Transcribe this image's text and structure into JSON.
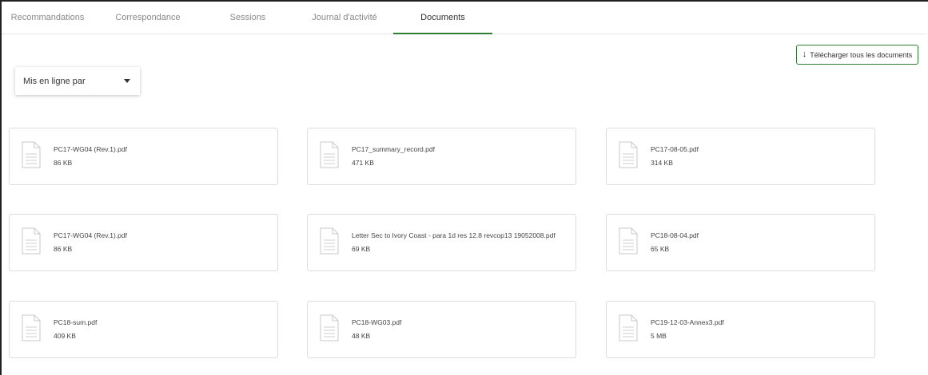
{
  "tabs": [
    {
      "label": "Recommandations",
      "active": false
    },
    {
      "label": "Correspondance",
      "active": false
    },
    {
      "label": "Sessions",
      "active": false
    },
    {
      "label": "Journal d'activité",
      "active": false
    },
    {
      "label": "Documents",
      "active": true
    }
  ],
  "toolbar": {
    "download_all_label": "Télécharger tous les documents",
    "download_icon": "download-arrow-icon"
  },
  "filter": {
    "selected": "Mis en ligne par"
  },
  "colors": {
    "accent": "#2e7d32",
    "tab_inactive": "#8a8a8a"
  },
  "documents": [
    {
      "name": "PC17-WG04 (Rev.1).pdf",
      "size": "86 KB",
      "icon": "file-document-icon"
    },
    {
      "name": "PC17_summary_record.pdf",
      "size": "471 KB",
      "icon": "file-document-icon"
    },
    {
      "name": "PC17-08-05.pdf",
      "size": "314 KB",
      "icon": "file-document-icon"
    },
    {
      "name": "PC17-WG04 (Rev.1).pdf",
      "size": "86 KB",
      "icon": "file-document-icon"
    },
    {
      "name": "Letter Sec to Ivory Coast - para 1d res 12.8 revcop13 19052008.pdf",
      "size": "69 KB",
      "icon": "file-document-icon"
    },
    {
      "name": "PC18-08-04.pdf",
      "size": "65 KB",
      "icon": "file-document-icon"
    },
    {
      "name": "PC18-sum.pdf",
      "size": "409 KB",
      "icon": "file-document-icon"
    },
    {
      "name": "PC18-WG03.pdf",
      "size": "48 KB",
      "icon": "file-document-icon"
    },
    {
      "name": "PC19-12-03-Annex3.pdf",
      "size": "5 MB",
      "icon": "file-document-icon"
    }
  ]
}
